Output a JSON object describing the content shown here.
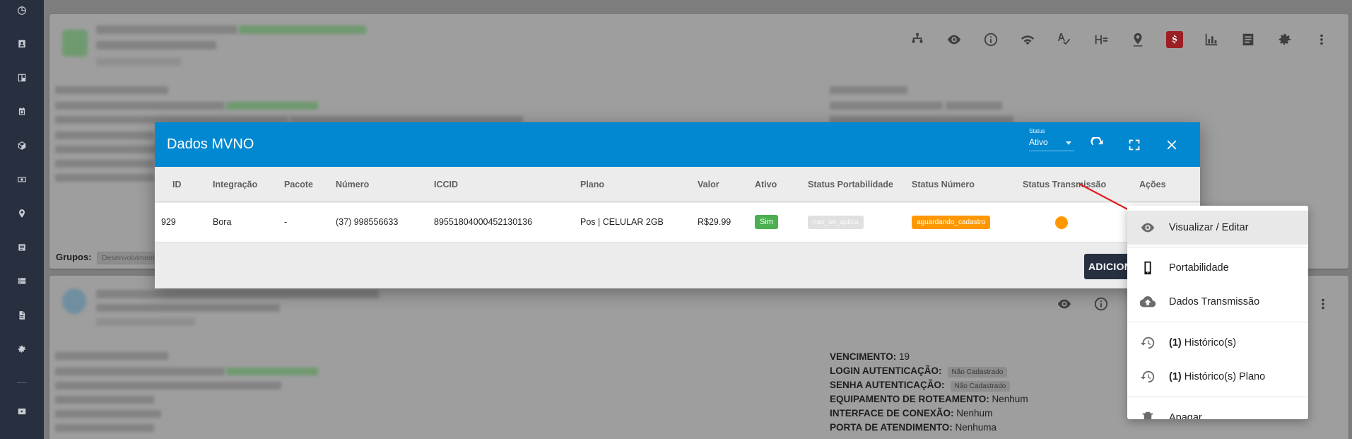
{
  "dialog": {
    "title": "Dados MVNO",
    "status_caption": "Status",
    "status_value": "Ativo",
    "headers": {
      "id": "ID",
      "integracao": "Integração",
      "pacote": "Pacote",
      "numero": "Número",
      "iccid": "ICCID",
      "plano": "Plano",
      "valor": "Valor",
      "ativo": "Ativo",
      "status_portabilidade": "Status Portabilidade",
      "status_numero": "Status Número",
      "status_transmissao": "Status Transmissão",
      "acoes": "Ações"
    },
    "row": {
      "id": "929",
      "integracao": "Bora",
      "pacote": "-",
      "numero": "(37) 998556633",
      "iccid": "89551804000452130136",
      "plano": "Pos | CELULAR 2GB",
      "valor": "R$29.99",
      "ativo": "Sim",
      "status_portabilidade": "nao_se_aplica",
      "status_numero": "aguardando_cadastro",
      "status_transmissao_color": "#ff9800"
    },
    "add_button": "ADICION"
  },
  "menu": {
    "items": [
      {
        "label": "Visualizar / Editar",
        "icon": "eye-icon"
      },
      {
        "label": "Portabilidade",
        "icon": "phone-icon"
      },
      {
        "label": "Dados Transmissão",
        "icon": "cloud-upload-icon"
      },
      {
        "count": "(1)",
        "label": " Histórico(s)",
        "icon": "history-icon"
      },
      {
        "count": "(1)",
        "label": " Histórico(s) Plano",
        "icon": "history-icon"
      },
      {
        "label": "Apagar",
        "icon": "delete-icon"
      }
    ]
  },
  "background": {
    "groups_label": "Grupos:",
    "group_tag": "Desenvolviment",
    "contract2": {
      "vencimento_label": "VENCIMENTO:",
      "vencimento_value": "19",
      "login_label": "LOGIN AUTENTICAÇÃO:",
      "login_value": "Não Cadastrado",
      "senha_label": "SENHA AUTENTICAÇÃO:",
      "senha_value": "Não Cadastrado",
      "equip_label": "EQUIPAMENTO DE ROTEAMENTO:",
      "equip_value": "Nenhum",
      "interface_label": "INTERFACE DE CONEXÃO:",
      "interface_value": "Nenhum",
      "porta_label": "PORTA DE ATENDIMENTO:",
      "porta_value": "Nenhuma"
    }
  },
  "colors": {
    "dialog_header": "#0288d1",
    "chip_active": "#4caf50",
    "chip_status_numero": "#ff9800",
    "money_icon_bg": "#9b1f24",
    "annotation_arrow": "#e01e1e"
  }
}
